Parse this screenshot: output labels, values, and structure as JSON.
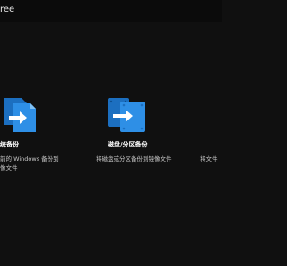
{
  "window": {
    "title": "ree"
  },
  "cards": [
    {
      "title": "统备份",
      "desc_line1": "前的 Windows 备份到",
      "desc_line2": "像文件",
      "icon": "system-backup-icon"
    },
    {
      "title": "磁盘/分区备份",
      "desc_line1": "将磁盘或分区备份到镜像文件",
      "icon": "disk-partition-backup-icon"
    },
    {
      "desc_line1": "将文件",
      "icon": "file-backup-icon"
    }
  ],
  "colors": {
    "background": "#101010",
    "icon_blue": "#2e8fe6",
    "icon_blue_dark": "#1c6fc0",
    "arrow": "#ffffff"
  }
}
